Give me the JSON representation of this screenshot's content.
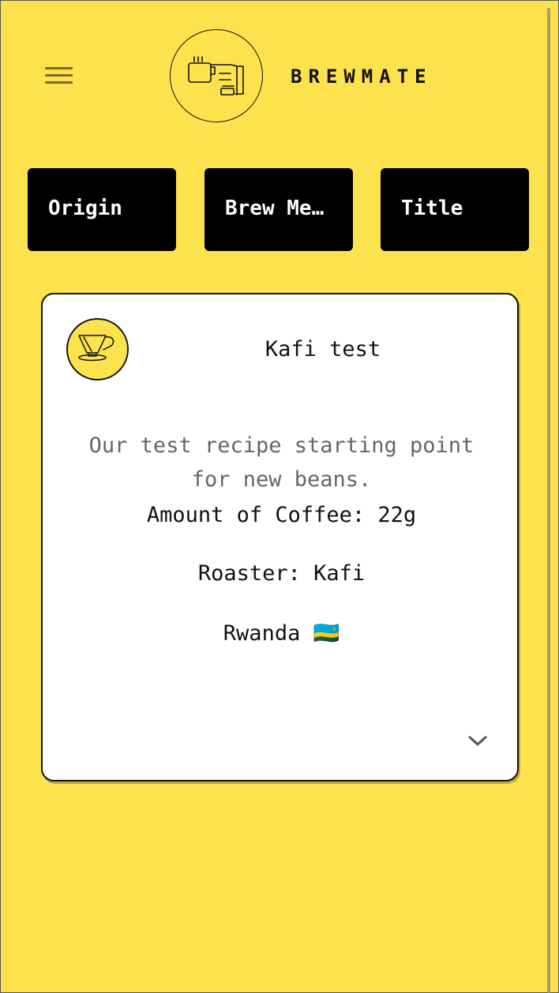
{
  "header": {
    "brand": "BREWMATE",
    "menu_icon": "hamburger-menu-icon",
    "logo_icon": "hand-holding-coffee-cup-icon"
  },
  "filters": [
    {
      "label": "Origin"
    },
    {
      "label": "Brew Method"
    },
    {
      "label": "Title"
    }
  ],
  "recipe_card": {
    "title": "Kafi test",
    "description": "Our test recipe starting point for new beans.",
    "amount": "Amount of Coffee: 22g",
    "roaster": "Roaster: Kafi",
    "origin": "Rwanda 🇷🇼",
    "brewer_icon": "pour-over-dripper-icon",
    "expand_icon": "chevron-down-icon"
  },
  "colors": {
    "background": "#fce34d",
    "button_bg": "#000000",
    "card_bg": "#ffffff",
    "muted_text": "#666666"
  }
}
